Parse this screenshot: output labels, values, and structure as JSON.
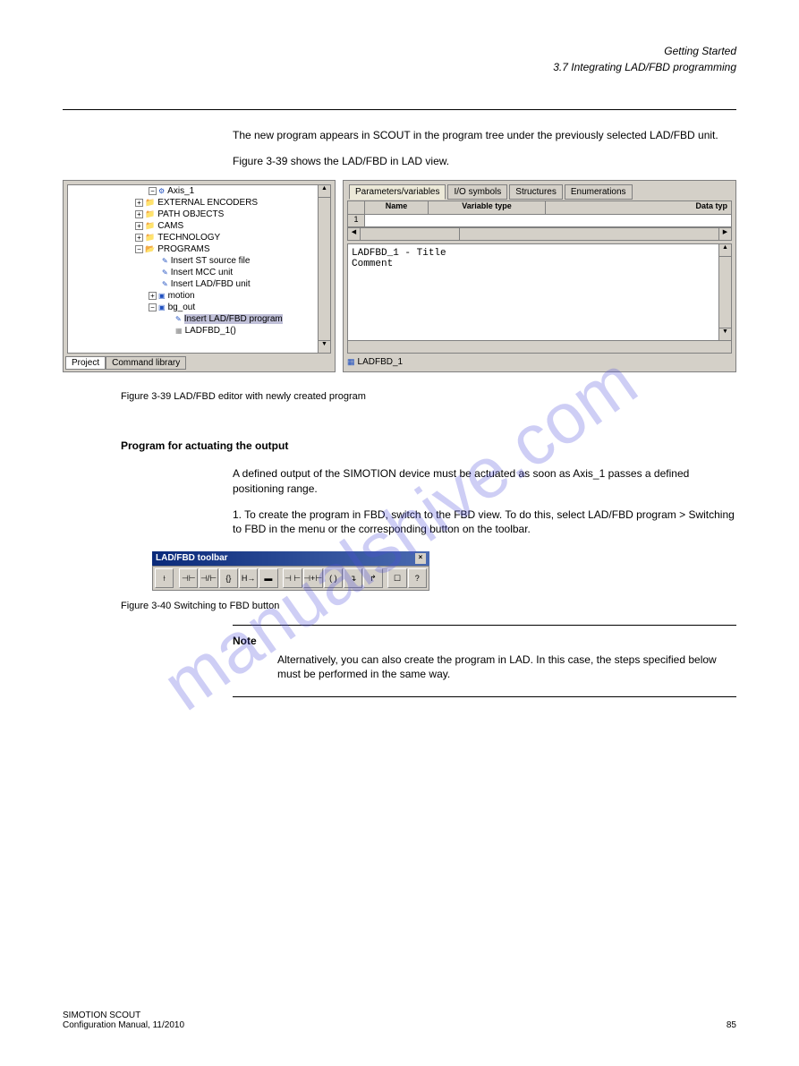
{
  "header": {
    "line1": "Getting Started",
    "line2": "3.7 Integrating LAD/FBD programming"
  },
  "para1": "The new program appears in SCOUT in the program tree under the previously selected LAD/FBD unit.",
  "para2": "Figure 3-39 shows the LAD/FBD in LAD view.",
  "tree": {
    "items": [
      {
        "indent": 90,
        "exp": "",
        "icon": "axis-icon",
        "label": "Axis_1"
      },
      {
        "indent": 75,
        "exp": "+",
        "icon": "folder-icon",
        "label": "EXTERNAL ENCODERS"
      },
      {
        "indent": 75,
        "exp": "+",
        "icon": "folder-icon",
        "label": "PATH OBJECTS"
      },
      {
        "indent": 75,
        "exp": "+",
        "icon": "folder-icon",
        "label": "CAMS"
      },
      {
        "indent": 75,
        "exp": "+",
        "icon": "folder-icon",
        "label": "TECHNOLOGY"
      },
      {
        "indent": 75,
        "exp": "−",
        "icon": "folder-icon",
        "label": "PROGRAMS"
      },
      {
        "indent": 105,
        "exp": "",
        "icon": "insert-icon",
        "label": "Insert ST source file"
      },
      {
        "indent": 105,
        "exp": "",
        "icon": "insert-icon",
        "label": "Insert MCC unit"
      },
      {
        "indent": 105,
        "exp": "",
        "icon": "insert-icon",
        "label": "Insert LAD/FBD unit"
      },
      {
        "indent": 90,
        "exp": "+",
        "icon": "unit-icon",
        "label": "motion"
      },
      {
        "indent": 90,
        "exp": "−",
        "icon": "unit-icon",
        "label": "bg_out"
      },
      {
        "indent": 120,
        "exp": "",
        "icon": "insert-icon",
        "label": "Insert LAD/FBD program",
        "sel": true
      },
      {
        "indent": 120,
        "exp": "",
        "icon": "prog-icon",
        "label": "LADFBD_1()"
      }
    ],
    "tabs": [
      "Project",
      "Command library"
    ]
  },
  "editor": {
    "tabs": [
      "Parameters/variables",
      "I/O symbols",
      "Structures",
      "Enumerations"
    ],
    "headers": {
      "name": "Name",
      "vartype": "Variable type",
      "datatype": "Data typ"
    },
    "row1": "1",
    "body_title": "LADFBD_1 - Title",
    "body_comment": "Comment",
    "bottom_tab": "LADFBD_1"
  },
  "figcap1": "Figure 3-39  LAD/FBD editor with newly created program",
  "section_h": "Program for actuating the output",
  "para3": "A defined output of the SIMOTION device must be actuated as soon as Axis_1 passes a defined positioning range.",
  "para4": "1.  To create the program in FBD, switch to the FBD view. To do this, select LAD/FBD program > Switching to FBD in the menu or the corresponding button on the toolbar.",
  "toolbar": {
    "title": "LAD/FBD toolbar",
    "buttons": [
      "⟊",
      "⊣⊢",
      "⊣/⊢",
      "{}",
      "H→",
      "▬",
      "⊣ ⊢",
      "⊣+⊢",
      "( )",
      "↴",
      "↱",
      "☐",
      "?"
    ]
  },
  "figcap2": "Figure 3-40  Switching to FBD button",
  "note": {
    "label": "Note",
    "text": "Alternatively, you can also create the program in LAD. In this case, the steps specified below must be performed in the same way."
  },
  "footer": {
    "left1": "SIMOTION SCOUT",
    "left2": "Configuration Manual, 11/2010",
    "right": "85"
  },
  "watermark": "manualshive.com"
}
